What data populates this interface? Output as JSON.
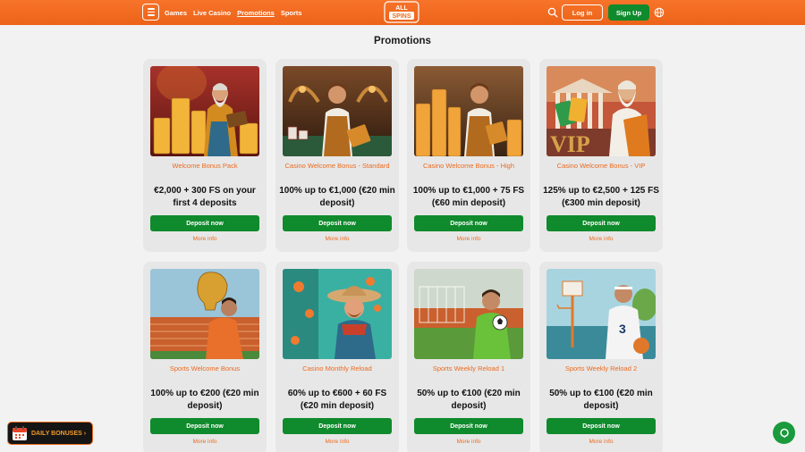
{
  "header": {
    "nav": [
      "Games",
      "Live Casino",
      "Promotions",
      "Sports"
    ],
    "active_nav": "Promotions",
    "logo_text_top": "ALL",
    "logo_text_bottom": "SPINS",
    "login_label": "Log in",
    "signup_label": "Sign Up"
  },
  "page": {
    "title": "Promotions"
  },
  "promotions": [
    {
      "title": "Welcome Bonus Pack",
      "offer": "€2,000 + 300 FS on your first 4 deposits",
      "deposit_label": "Deposit now",
      "more_label": "More info",
      "theme": "wizard-gold"
    },
    {
      "title": "Casino Welcome Bonus - Standard",
      "offer": "100% up to €1,000 (€20 min deposit)",
      "deposit_label": "Deposit now",
      "more_label": "More info",
      "theme": "dealer-casino"
    },
    {
      "title": "Casino Welcome Bonus - High",
      "offer": "100% up to €1,000 + 75 FS (€60 min deposit)",
      "deposit_label": "Deposit now",
      "more_label": "More info",
      "theme": "dealer-coins"
    },
    {
      "title": "Casino Welcome Bonus - VIP",
      "offer": "125% up to €2,500 + 125 FS (€300 min deposit)",
      "deposit_label": "Deposit now",
      "more_label": "More info",
      "theme": "vip-zeus",
      "image_text": "VIP"
    },
    {
      "title": "Sports Welcome Bonus",
      "offer": "100% up to €200 (€20 min deposit)",
      "deposit_label": "Deposit now",
      "more_label": "More info",
      "theme": "trophy-stadium"
    },
    {
      "title": "Casino Monthly Reload",
      "offer": "60% up to €600 + 60 FS (€20 min deposit)",
      "deposit_label": "Deposit now",
      "more_label": "More info",
      "theme": "cowboy-teal"
    },
    {
      "title": "Sports Weekly Reload 1",
      "offer": "50% up to €100 (€20 min deposit)",
      "deposit_label": "Deposit now",
      "more_label": "More info",
      "theme": "goalkeeper"
    },
    {
      "title": "Sports Weekly Reload 2",
      "offer": "50% up to €100 (€20 min deposit)",
      "deposit_label": "Deposit now",
      "more_label": "More info",
      "theme": "basketball",
      "image_text": "3"
    }
  ],
  "daily_bonuses": {
    "label": "DAILY BONUSES"
  },
  "colors": {
    "brand_orange": "#ec6a1e",
    "cta_green": "#0f8a2c",
    "background": "#f2f2f2",
    "card": "#e7e7e7"
  },
  "icons": [
    "menu-icon",
    "search-icon",
    "globe-icon",
    "calendar-icon",
    "chat-icon"
  ]
}
